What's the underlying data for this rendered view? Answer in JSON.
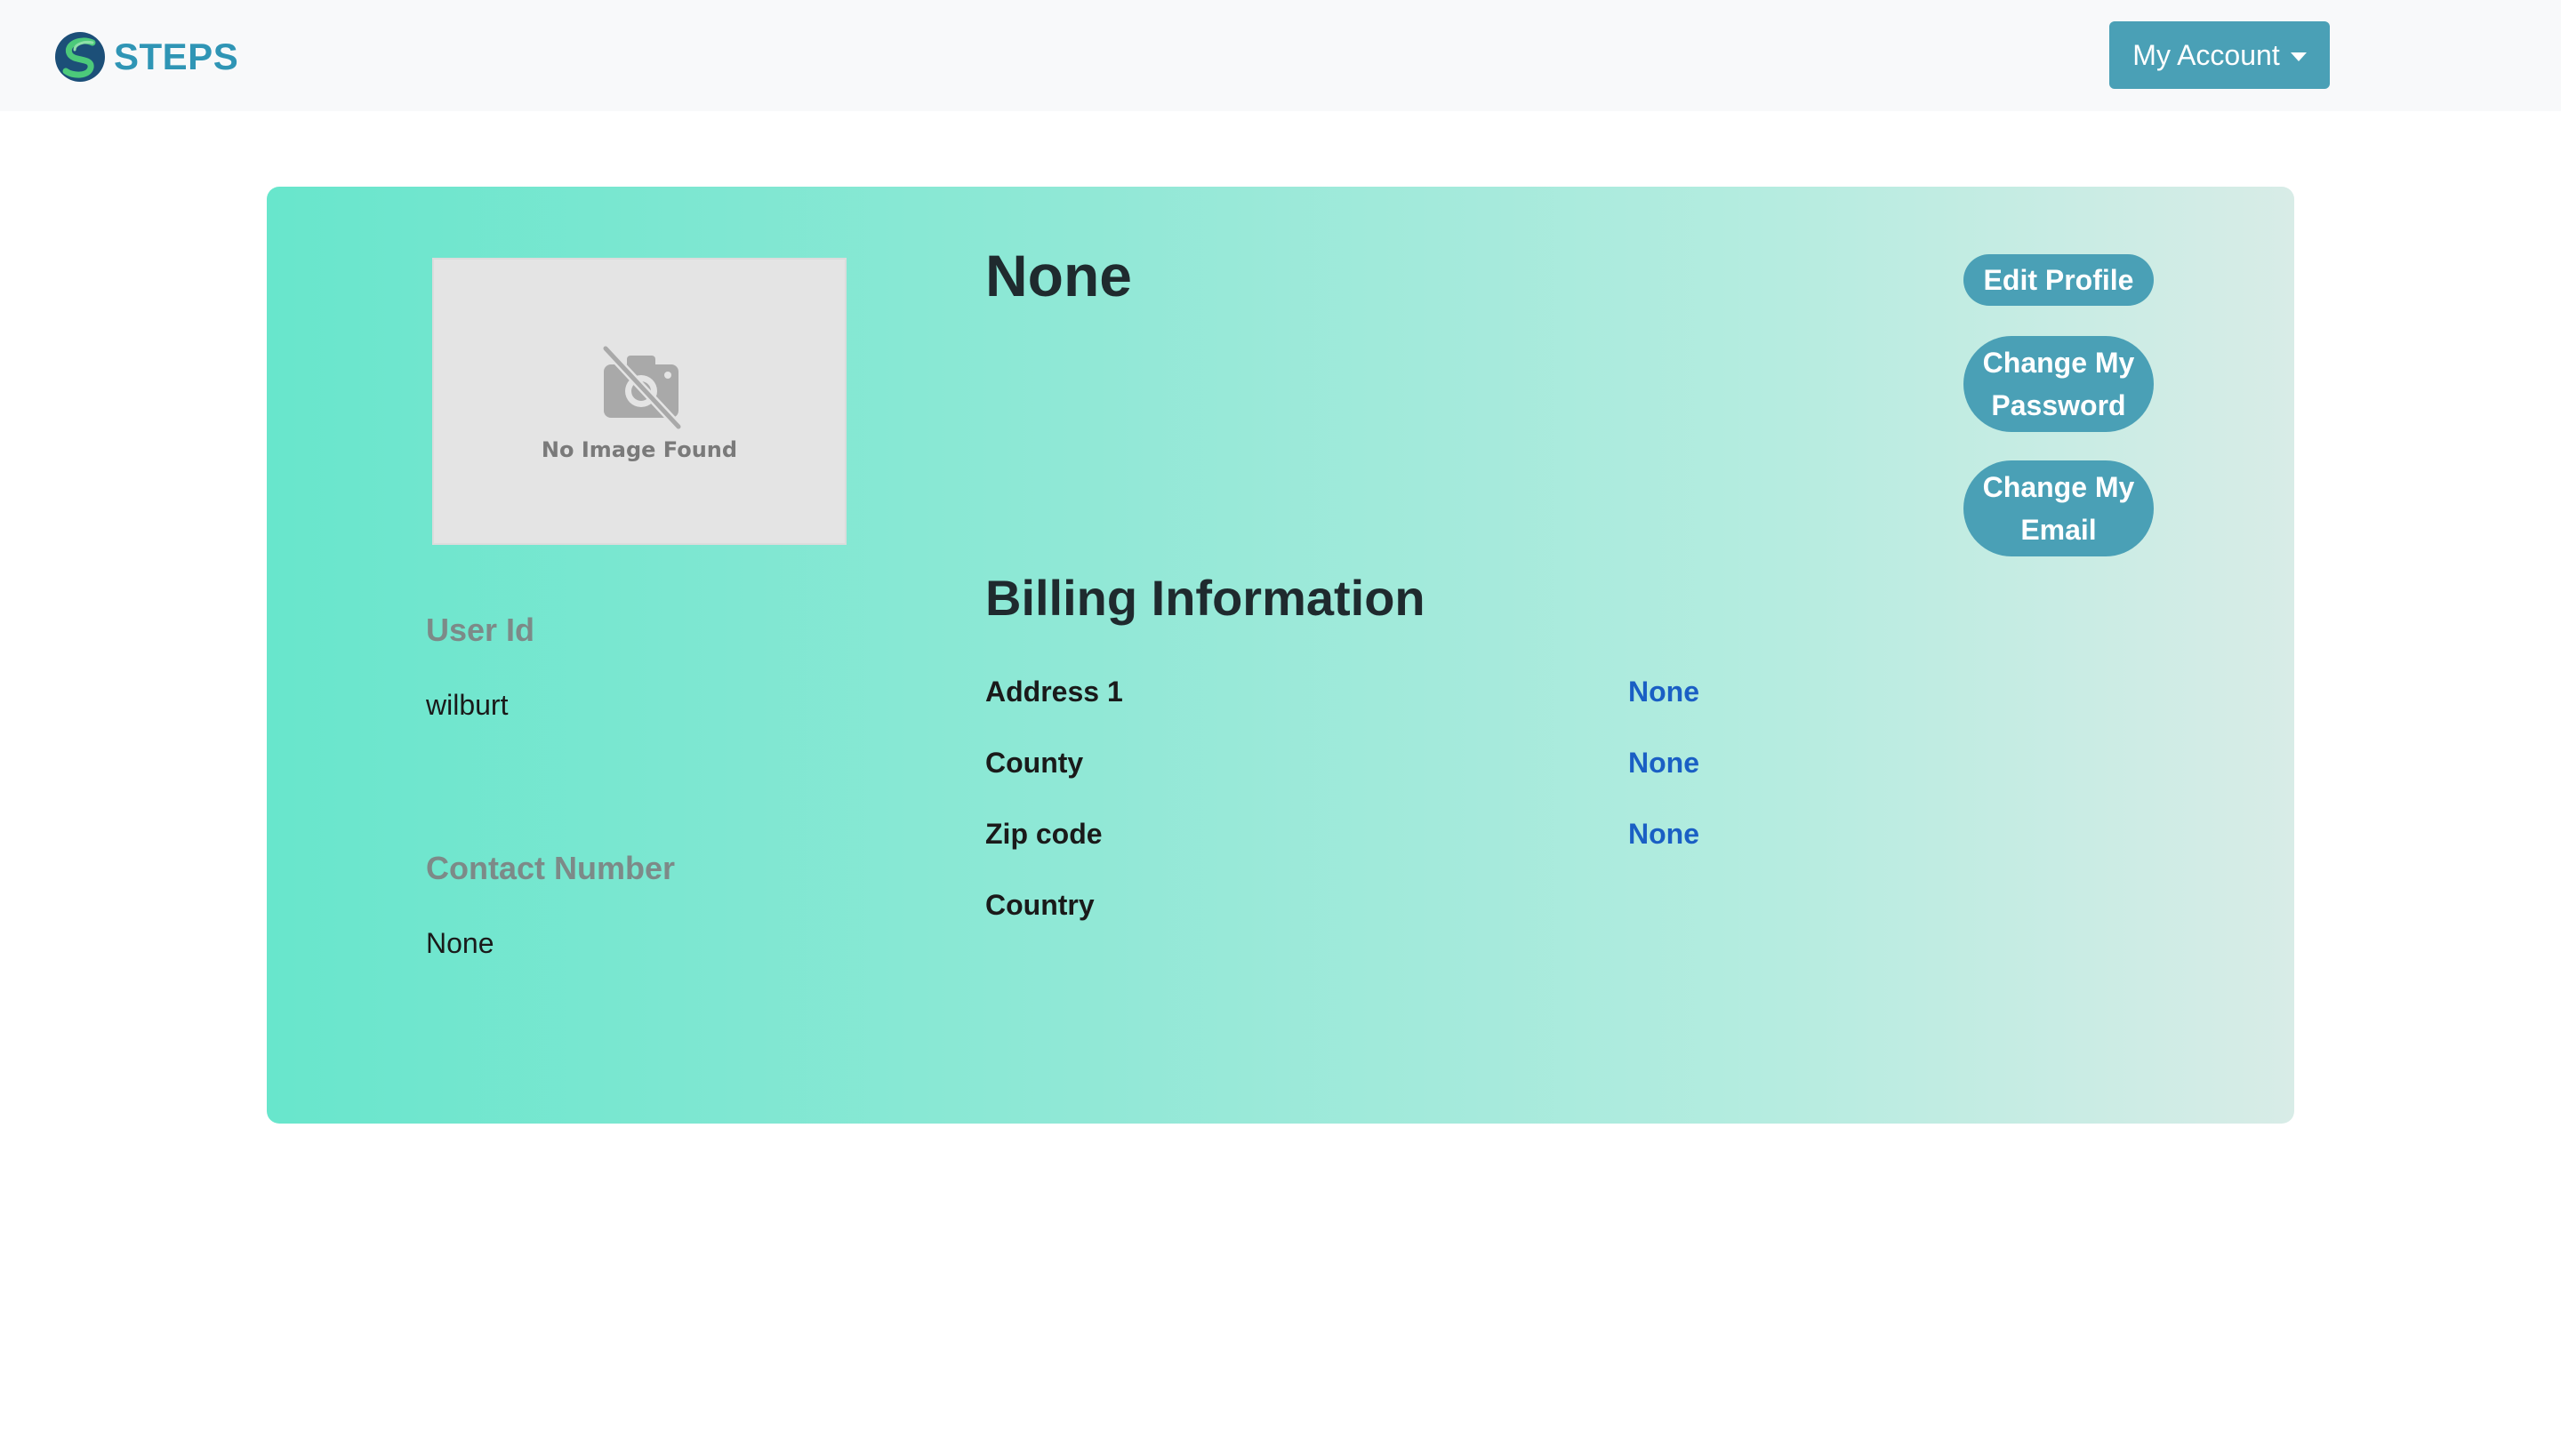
{
  "navbar": {
    "brand_text": "STEPS",
    "account_label": "My Account"
  },
  "profile": {
    "name": "None",
    "photo_placeholder": "No Image Found",
    "user_id_label": "User Id",
    "user_id_value": "wilburt",
    "contact_label": "Contact Number",
    "contact_value": "None"
  },
  "actions": {
    "edit_profile": "Edit Profile",
    "change_password": "Change My Password",
    "change_email": "Change My Email"
  },
  "billing": {
    "title": "Billing Information",
    "rows": [
      {
        "label": "Address 1",
        "value": "None"
      },
      {
        "label": "County",
        "value": "None"
      },
      {
        "label": "Zip code",
        "value": "None"
      },
      {
        "label": "Country",
        "value": ""
      }
    ]
  },
  "colors": {
    "navbar_bg": "#f8f9fa",
    "brand": "#2f95b5",
    "button": "#4aa0b6",
    "link": "#1a5fc4",
    "card_gradient_start": "#68e6cc",
    "card_gradient_end": "#d8ece7"
  },
  "icons": {
    "brand_logo": "steps-logo-icon",
    "account_caret": "chevron-down-icon",
    "photo_placeholder": "camera-off-icon"
  }
}
